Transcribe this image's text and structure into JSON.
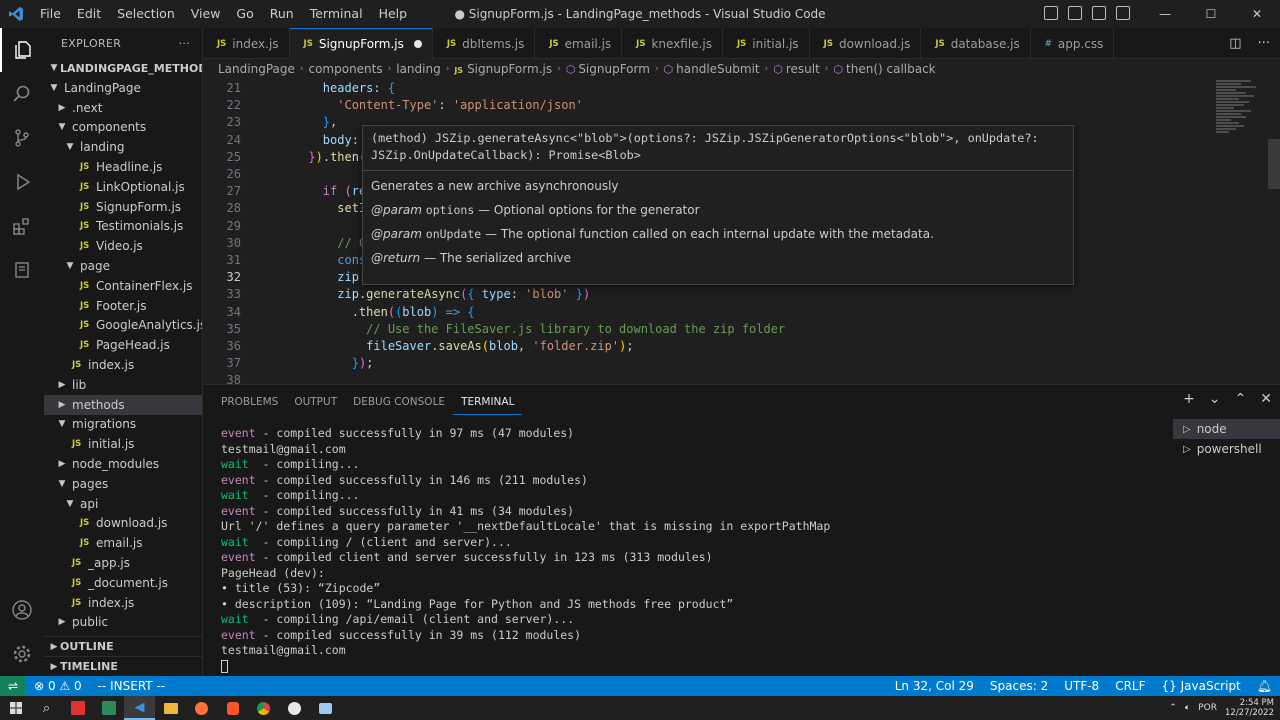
{
  "window": {
    "title": "● SignupForm.js - LandingPage_methods - Visual Studio Code",
    "menu": [
      "File",
      "Edit",
      "Selection",
      "View",
      "Go",
      "Run",
      "Terminal",
      "Help"
    ],
    "controls": [
      "—",
      "☐",
      "✕"
    ]
  },
  "sidebar": {
    "title": "EXPLORER",
    "more": "···",
    "root": "LANDINGPAGE_METHODS",
    "tree": [
      {
        "label": "LandingPage",
        "indent": 1,
        "type": "folder-open"
      },
      {
        "label": ".next",
        "indent": 2,
        "type": "folder"
      },
      {
        "label": "components",
        "indent": 2,
        "type": "folder-open"
      },
      {
        "label": "landing",
        "indent": 3,
        "type": "folder-open"
      },
      {
        "label": "Headline.js",
        "indent": 4,
        "type": "js"
      },
      {
        "label": "LinkOptional.js",
        "indent": 4,
        "type": "js"
      },
      {
        "label": "SignupForm.js",
        "indent": 4,
        "type": "js"
      },
      {
        "label": "Testimonials.js",
        "indent": 4,
        "type": "js"
      },
      {
        "label": "Video.js",
        "indent": 4,
        "type": "js"
      },
      {
        "label": "page",
        "indent": 3,
        "type": "folder-open"
      },
      {
        "label": "ContainerFlex.js",
        "indent": 4,
        "type": "js"
      },
      {
        "label": "Footer.js",
        "indent": 4,
        "type": "js"
      },
      {
        "label": "GoogleAnalytics.js",
        "indent": 4,
        "type": "js"
      },
      {
        "label": "PageHead.js",
        "indent": 4,
        "type": "js"
      },
      {
        "label": "index.js",
        "indent": 3,
        "type": "js"
      },
      {
        "label": "lib",
        "indent": 2,
        "type": "folder"
      },
      {
        "label": "methods",
        "indent": 2,
        "type": "folder",
        "selected": true
      },
      {
        "label": "migrations",
        "indent": 2,
        "type": "folder-open"
      },
      {
        "label": "initial.js",
        "indent": 3,
        "type": "js"
      },
      {
        "label": "node_modules",
        "indent": 2,
        "type": "folder"
      },
      {
        "label": "pages",
        "indent": 2,
        "type": "folder-open"
      },
      {
        "label": "api",
        "indent": 3,
        "type": "folder-open"
      },
      {
        "label": "download.js",
        "indent": 4,
        "type": "js"
      },
      {
        "label": "email.js",
        "indent": 4,
        "type": "js"
      },
      {
        "label": "_app.js",
        "indent": 3,
        "type": "js"
      },
      {
        "label": "_document.js",
        "indent": 3,
        "type": "js"
      },
      {
        "label": "index.js",
        "indent": 3,
        "type": "js"
      },
      {
        "label": "public",
        "indent": 2,
        "type": "folder"
      }
    ],
    "outline": "OUTLINE",
    "timeline": "TIMELINE"
  },
  "tabs": [
    {
      "label": "index.js",
      "type": "js"
    },
    {
      "label": "SignupForm.js",
      "type": "js",
      "active": true,
      "dirty": true
    },
    {
      "label": "dbItems.js",
      "type": "js"
    },
    {
      "label": "email.js",
      "type": "js"
    },
    {
      "label": "knexfile.js",
      "type": "js"
    },
    {
      "label": "initial.js",
      "type": "js"
    },
    {
      "label": "download.js",
      "type": "js"
    },
    {
      "label": "database.js",
      "type": "js"
    },
    {
      "label": "app.css",
      "type": "css"
    }
  ],
  "breadcrumb": [
    "LandingPage",
    "components",
    "landing",
    "SignupForm.js",
    "SignupForm",
    "handleSubmit",
    "result",
    "then() callback"
  ],
  "editor": {
    "line_numbers": [
      "21",
      "22",
      "23",
      "24",
      "25",
      "26",
      "27",
      "28",
      "29",
      "30",
      "31",
      "32",
      "33",
      "34",
      "35",
      "36",
      "37",
      "38"
    ],
    "current_line": "32",
    "lines": [
      "        headers: {",
      "          'Content-Type': 'application/json'",
      "        },",
      "        body: ",
      "      }).then(",
      "",
      "        if (re",
      "          setI",
      "",
      "          // C",
      "          cons",
      "          zip.",
      "          zip.generateAsync({ type: 'blob' })",
      "            .then((blob) => {",
      "              // Use the FileSaver.js library to download the zip folder",
      "              fileSaver.saveAs(blob, 'folder.zip');",
      "            });",
      ""
    ]
  },
  "hover": {
    "signature": "(method) JSZip.generateAsync<\"blob\">(options?: JSZip.JSZipGeneratorOptions<\"blob\">, onUpdate?: JSZip.OnUpdateCallback): Promise<Blob>",
    "summary": "Generates a new archive asynchronously",
    "param1_tag": "@param",
    "param1_name": "options",
    "param1_desc": "— Optional options for the generator",
    "param2_tag": "@param",
    "param2_name": "onUpdate",
    "param2_desc": "— The optional function called on each internal update with the metadata.",
    "return_tag": "@return",
    "return_desc": "— The serialized archive"
  },
  "panel": {
    "tabs": [
      "PROBLEMS",
      "OUTPUT",
      "DEBUG CONSOLE",
      "TERMINAL"
    ],
    "active_tab": "TERMINAL",
    "terminal_lines": [
      {
        "pre": "event",
        "text": " - compiled successfully in 97 ms (47 modules)"
      },
      {
        "pre": "",
        "text": "testmail@gmail.com"
      },
      {
        "pre": "wait",
        "text": "  - compiling..."
      },
      {
        "pre": "event",
        "text": " - compiled successfully in 146 ms (211 modules)"
      },
      {
        "pre": "wait",
        "text": "  - compiling..."
      },
      {
        "pre": "event",
        "text": " - compiled successfully in 41 ms (34 modules)"
      },
      {
        "pre": "",
        "text": "Url '/' defines a query parameter '__nextDefaultLocale' that is missing in exportPathMap"
      },
      {
        "pre": "wait",
        "text": "  - compiling / (client and server)..."
      },
      {
        "pre": "event",
        "text": " - compiled client and server successfully in 123 ms (313 modules)"
      },
      {
        "pre": "",
        "text": "PageHead (dev):"
      },
      {
        "pre": "",
        "text": "• title (53): “Zipcode”"
      },
      {
        "pre": "",
        "text": "• description (109): “Landing Page for Python and JS methods free product”"
      },
      {
        "pre": "wait",
        "text": "  - compiling /api/email (client and server)..."
      },
      {
        "pre": "event",
        "text": " - compiled successfully in 39 ms (112 modules)"
      },
      {
        "pre": "",
        "text": "testmail@gmail.com"
      }
    ],
    "terminals": [
      "node",
      "powershell"
    ]
  },
  "statusbar": {
    "errors": "0",
    "warnings": "0",
    "mode": "-- INSERT --",
    "position": "Ln 32, Col 29",
    "spaces": "Spaces: 2",
    "encoding": "UTF-8",
    "eol": "CRLF",
    "language": "JavaScript"
  },
  "taskbar": {
    "lang": "POR",
    "time": "2:54 PM",
    "date": "12/27/2022"
  },
  "colors": {
    "accent": "#007acc",
    "editor_bg": "#1f1f1f",
    "sidebar_bg": "#181818"
  }
}
